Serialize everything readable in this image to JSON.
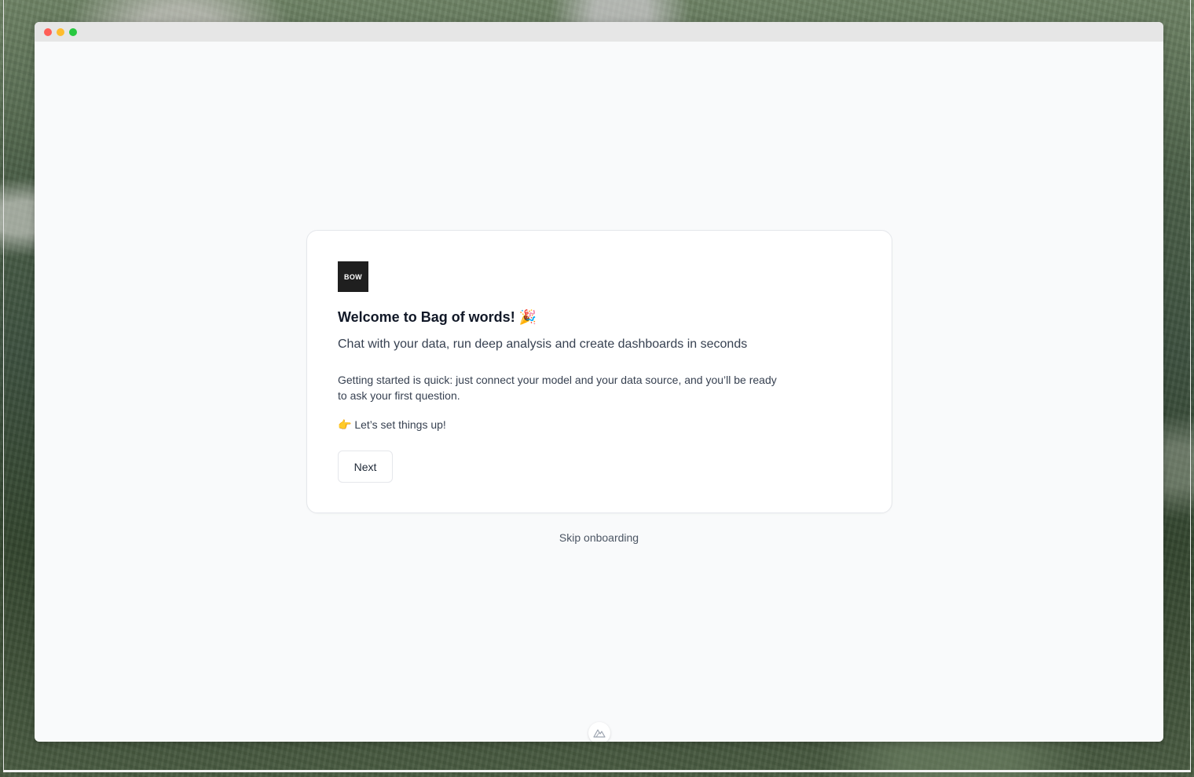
{
  "window": {
    "traffic_lights": [
      "close",
      "minimize",
      "zoom"
    ]
  },
  "onboarding": {
    "logo_text": "BOW",
    "title": "Welcome to Bag of words! 🎉",
    "subtitle": "Chat with your data, run deep analysis and create dashboards in seconds",
    "description": "Getting started is quick: just connect your model and your data source, and you’ll be ready to ask your first question.",
    "cta_text": "👉 Let’s set things up!",
    "next_label": "Next",
    "skip_label": "Skip onboarding"
  },
  "colors": {
    "logo_bg": "#1f1f1f",
    "window_bg": "#f9fafb",
    "card_bg": "#ffffff"
  },
  "icons": {
    "floating": "mountain-icon"
  }
}
